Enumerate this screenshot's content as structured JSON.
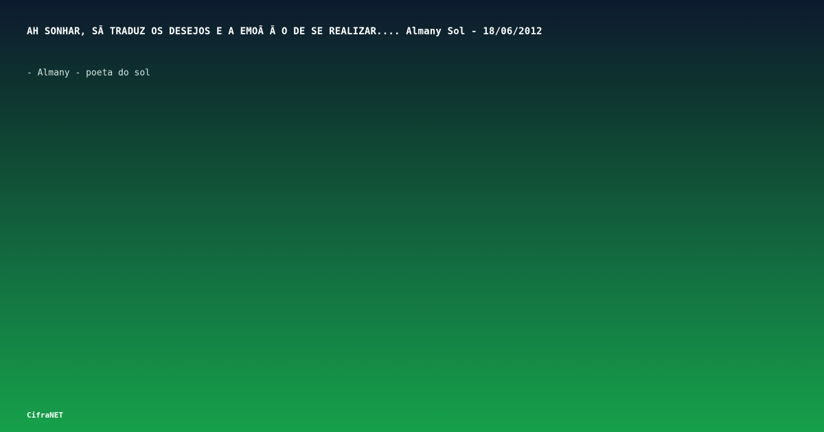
{
  "card": {
    "title": "AH SONHAR, SÃ  TRADUZ OS DESEJOS E A EMOÃ Ã O DE SE REALIZAR.... Almany Sol - 18/06/2012",
    "byline": "- Almany - poeta do sol",
    "brand": "CifraNET"
  }
}
